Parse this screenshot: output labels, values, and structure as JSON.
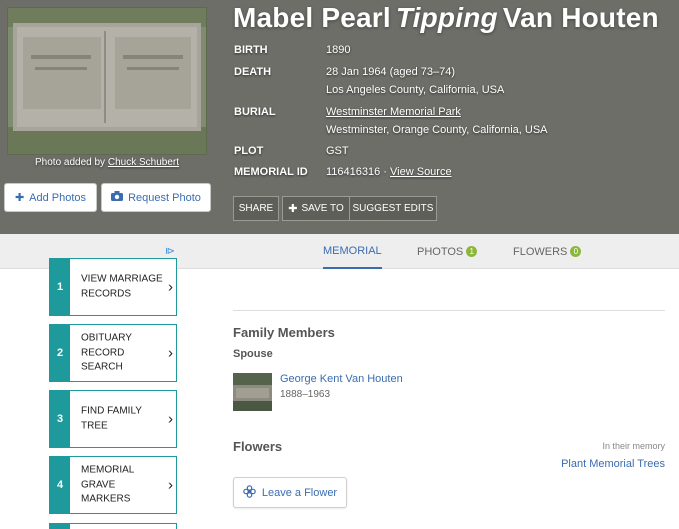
{
  "memorial": {
    "first_name": "Mabel Pearl",
    "maiden_name": "Tipping",
    "last_name": "Van Houten",
    "photo_caption_prefix": "Photo added by",
    "photo_caption_author": "Chuck Schubert",
    "add_photos_label": "Add Photos",
    "request_photo_label": "Request Photo"
  },
  "details": {
    "birth_label": "BIRTH",
    "birth_value": "1890",
    "death_label": "DEATH",
    "death_value": "28 Jan 1964 (aged 73–74)",
    "death_place": "Los Angeles County, California, USA",
    "burial_label": "BURIAL",
    "burial_value": "Westminster Memorial Park",
    "burial_place": "Westminster, Orange County, California, USA",
    "plot_label": "PLOT",
    "plot_value": "GST",
    "memorial_id_label": "MEMORIAL ID",
    "memorial_id_value": "116416316 ·",
    "view_source_label": "View Source"
  },
  "actions": {
    "share_label": "SHARE",
    "save_label": "SAVE TO",
    "suggest_label": "SUGGEST EDITS"
  },
  "tabs": [
    {
      "label": "MEMORIAL"
    },
    {
      "label": "PHOTOS",
      "count": "1"
    },
    {
      "label": "FLOWERS",
      "count": "0"
    }
  ],
  "ads": [
    {
      "num": "1",
      "label": "VIEW MARRIAGE RECORDS"
    },
    {
      "num": "2",
      "label": "OBITUARY RECORD SEARCH"
    },
    {
      "num": "3",
      "label": "FIND FAMILY TREE"
    },
    {
      "num": "4",
      "label": "MEMORIAL GRAVE MARKERS"
    }
  ],
  "family": {
    "title": "Family Members",
    "spouse_label": "Spouse",
    "spouse_name": "George Kent Van Houten",
    "spouse_dates": "1888–1963"
  },
  "flowers": {
    "title": "Flowers",
    "memory_text": "In their memory",
    "plant_label": "Plant Memorial Trees",
    "leave_label": "Leave a Flower"
  },
  "colors": {
    "hero_bg": "#6e6e68",
    "link": "#3a6db0",
    "ad_teal": "#1e9a9c",
    "badge_green": "#8bb83a"
  }
}
